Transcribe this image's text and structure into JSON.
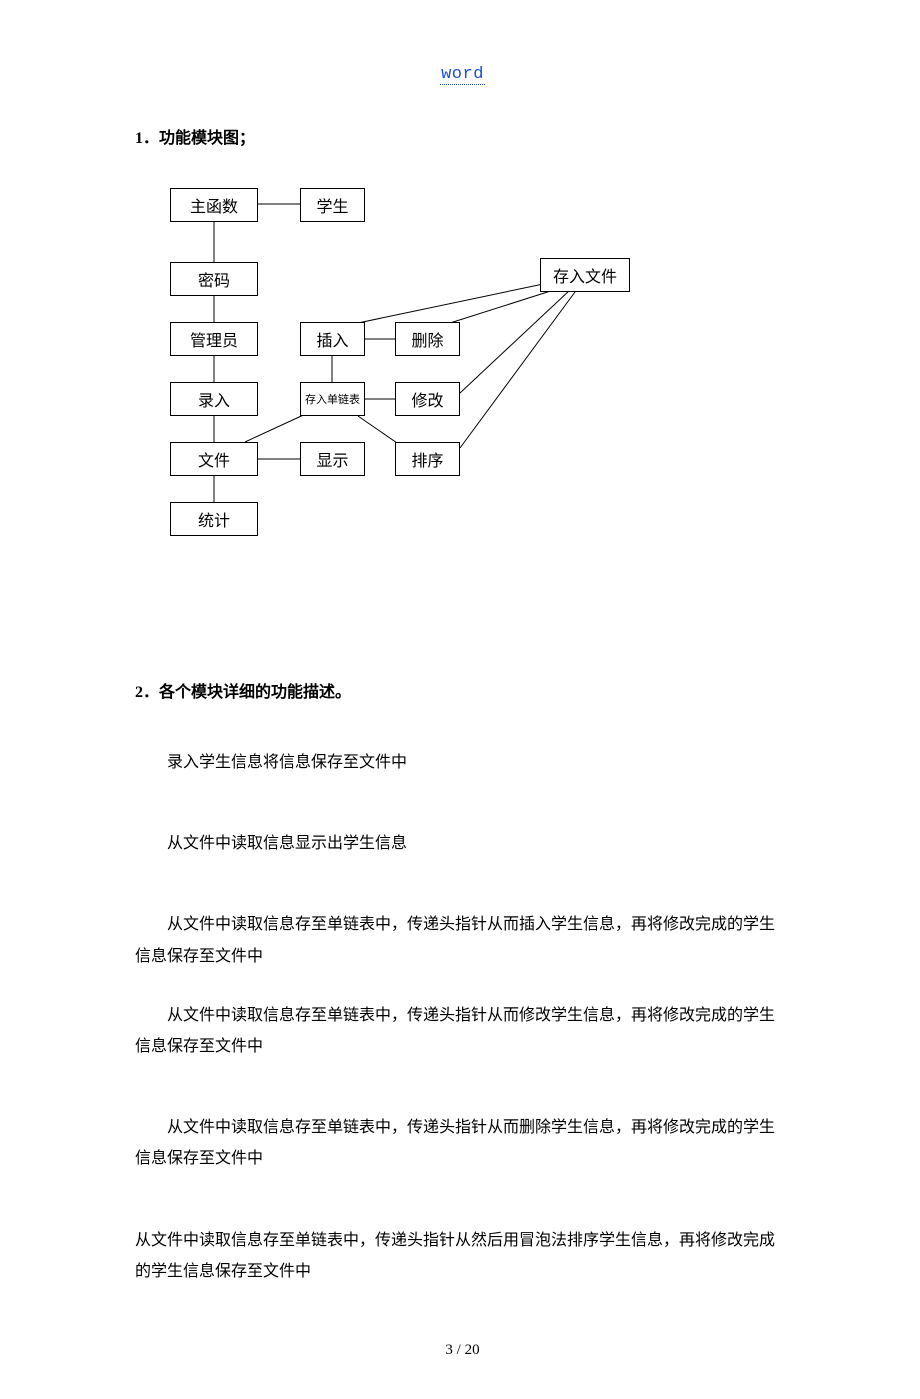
{
  "header": {
    "link_text": "word"
  },
  "sections": {
    "s1_title": "1．功能模块图；",
    "s2_title": "2．各个模块详细的功能描述。"
  },
  "diagram": {
    "main": "主函数",
    "student": "学生",
    "password": "密码",
    "savefile": "存入文件",
    "admin": "管理员",
    "insert": "插入",
    "delete": "删除",
    "input": "录入",
    "linkedlist": "存入单链表",
    "modify": "修改",
    "file": "文件",
    "show": "显示",
    "sort": "排序",
    "stats": "统计"
  },
  "desc": {
    "p1": "录入学生信息将信息保存至文件中",
    "p2": "从文件中读取信息显示出学生信息",
    "p3a": "从文件中读取信息存至单链表中，传递头指针从而插入学生信息，再将修改完成的学生",
    "p3b": "信息保存至文件中",
    "p4a": "从文件中读取信息存至单链表中，传递头指针从而修改学生信息，再将修改完成的学生",
    "p4b": "信息保存至文件中",
    "p5a": "从文件中读取信息存至单链表中，传递头指针从而删除学生信息，再将修改完成的学生",
    "p5b": "信息保存至文件中",
    "p6a": "从文件中读取信息存至单链表中，传递头指针从然后用冒泡法排序学生信息，再将修改完成",
    "p6b": "的学生信息保存至文件中"
  },
  "footer": {
    "page": "3 / 20"
  }
}
